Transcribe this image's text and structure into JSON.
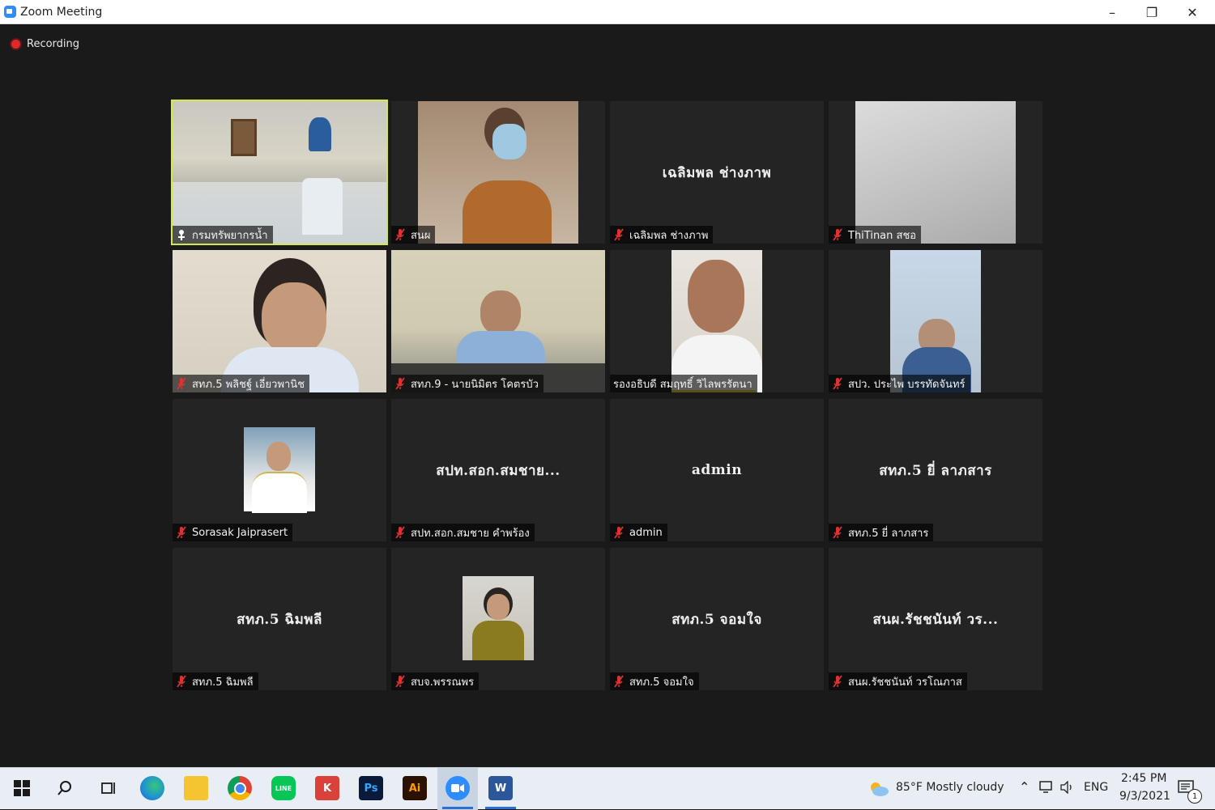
{
  "window": {
    "title": "Zoom Meeting"
  },
  "recording": {
    "label": "Recording"
  },
  "tiles": [
    {
      "name": "กรมทรัพยากรน้ำ"
    },
    {
      "name": "สนผ"
    },
    {
      "name": "เฉลิมพล ช่างภาพ",
      "display": "เฉลิมพล ช่างภาพ"
    },
    {
      "name": "ThiTinan สชอ"
    },
    {
      "name": "สทภ.5 พลิชฐ์ เอี่ยวพานิช"
    },
    {
      "name": "สทภ.9 - นายนิมิตร โคตรบัว"
    },
    {
      "name": "รองอธิบดี สมฤทธิ์ วิไลพรรัตนา"
    },
    {
      "name": "สปว. ประไพ บรรทัดจันทร์"
    },
    {
      "name": "Sorasak Jaiprasert"
    },
    {
      "name": "สปท.สอก.สมชาย คำพร้อง",
      "display": "สปท.สอก.สมชาย..."
    },
    {
      "name": "admin",
      "display": "admin"
    },
    {
      "name": "สทภ.5 ยี่ ลาภสาร",
      "display": "สทภ.5 ยี่ ลาภสาร"
    },
    {
      "name": "สทภ.5 ฉิมพลี",
      "display": "สทภ.5 ฉิมพลี"
    },
    {
      "name": "สบจ.พรรณพร"
    },
    {
      "name": "สทภ.5 จอมใจ",
      "display": "สทภ.5 จอมใจ"
    },
    {
      "name": "สนผ.รัชชนันท์ วรโณภาส",
      "display": "สนผ.รัชชนันท์ วร..."
    }
  ],
  "taskbar": {
    "weather": "85°F  Mostly cloudy",
    "language": "ENG",
    "time": "2:45 PM",
    "date": "9/3/2021",
    "notification_count": "1"
  }
}
